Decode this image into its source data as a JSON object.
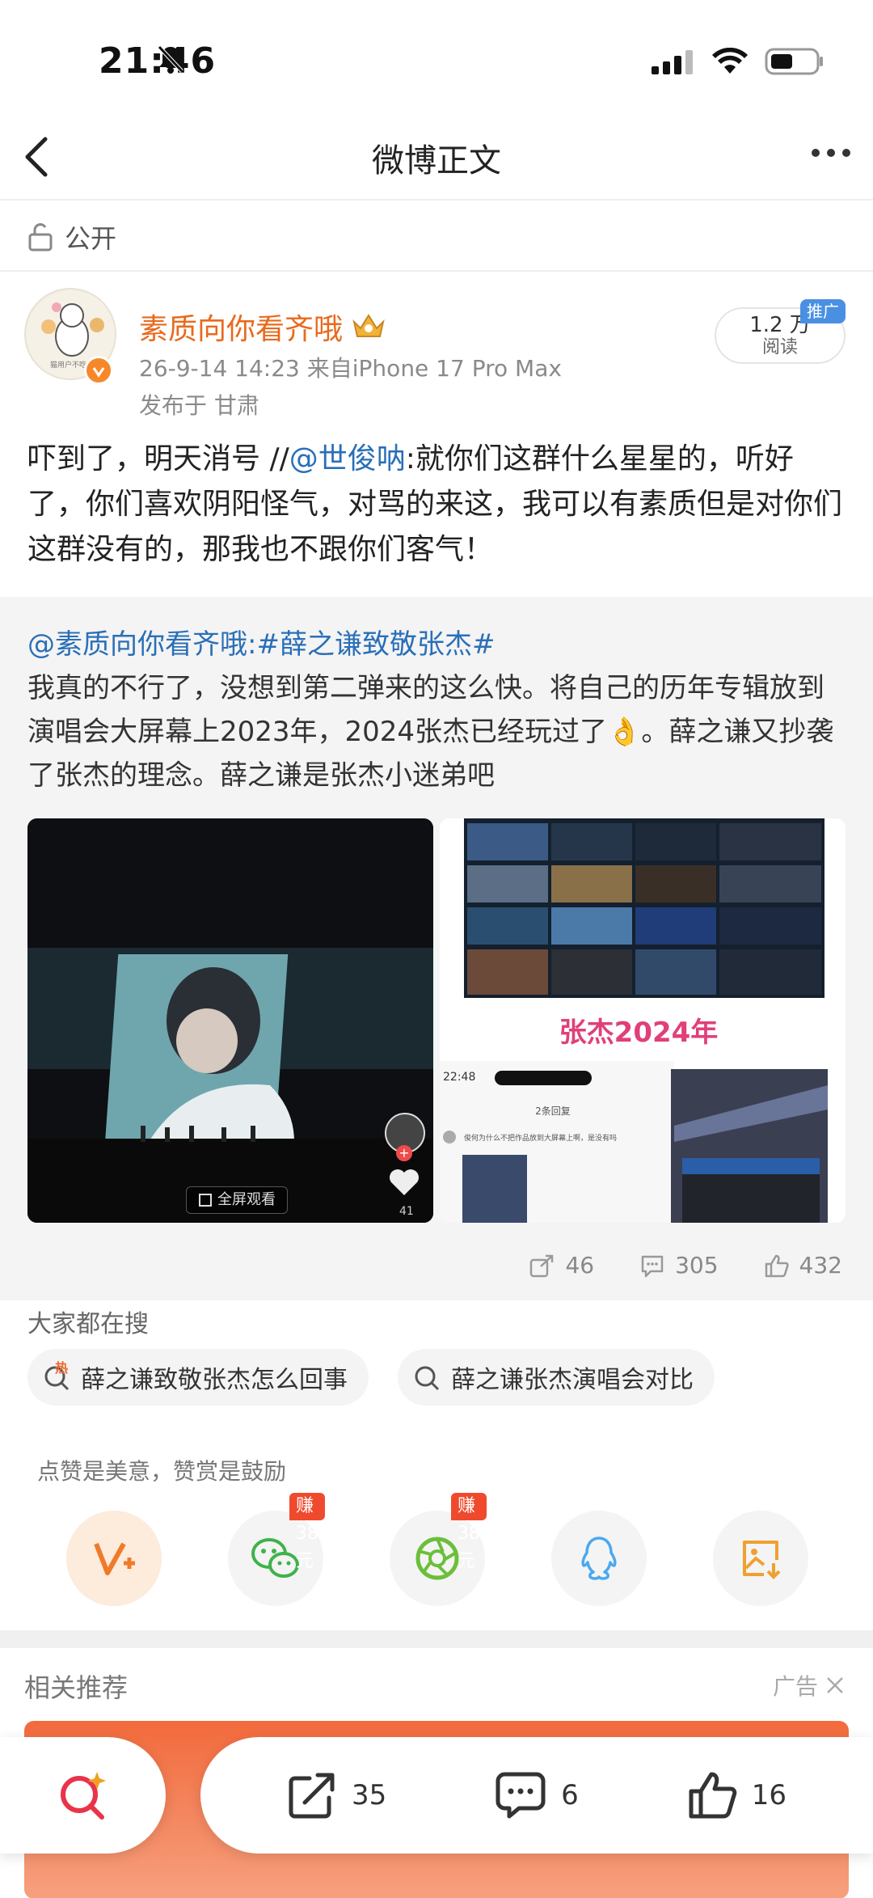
{
  "status_bar": {
    "time": "21:46"
  },
  "nav": {
    "title": "微博正文"
  },
  "visibility": {
    "label": "公开"
  },
  "author": {
    "name": "素质向你看齐哦",
    "meta": "26-9-14 14:23  来自iPhone 17 Pro Max",
    "location": "发布于 甘肃",
    "avatar_caption": "猫用户不吃亏",
    "reads": "1.2 万",
    "reads_label": "阅读",
    "promo_tag": "推广"
  },
  "post": {
    "prefix": "吓到了，明天消号 //",
    "mention": "@世俊呐",
    "body": ":就你们这群什么星星的，听好了，你们喜欢阴阳怪气，对骂的来这，我可以有素质但是对你们这群没有的，那我也不跟你们客气！"
  },
  "repost": {
    "author": "@素质向你看齐哦",
    "topic": ":#薛之谦致敬张杰#",
    "body": "我真的不行了，没想到第二弹来的这么快。将自己的历年专辑放到演唱会大屏幕上2023年，2024张杰已经玩过了👌。薛之谦又抄袭了张杰的理念。薛之谦是张杰小迷弟吧",
    "video_fullscreen": "全屏观看",
    "video_likes": "41",
    "image_caption": "张杰2024年",
    "screenshot_time": "22:48",
    "screenshot_replies": "2条回复",
    "screenshot_comment": "俊何为什么不把作品放到大屏幕上啊，是没有吗",
    "shares": "46",
    "comments": "305",
    "likes": "432"
  },
  "hot_search": {
    "title": "大家都在搜",
    "items": [
      {
        "label": "薛之谦致敬张杰怎么回事",
        "badge": "热"
      },
      {
        "label": "薛之谦张杰演唱会对比"
      }
    ]
  },
  "reward": {
    "hint": "点赞是美意，赞赏是鼓励",
    "buttons": [
      {
        "name": "reward",
        "badge": ""
      },
      {
        "name": "wechat",
        "badge": "赚38元"
      },
      {
        "name": "moments",
        "badge": "赚38元"
      },
      {
        "name": "qq",
        "badge": ""
      },
      {
        "name": "save-image",
        "badge": ""
      }
    ]
  },
  "related": {
    "title": "相关推荐",
    "ad_label": "广告"
  },
  "bottom_bar": {
    "shares": "35",
    "comments": "6",
    "likes": "16"
  },
  "colors": {
    "brand_orange": "#e86a1c",
    "link_blue": "#2a6fb8",
    "reward_red": "#f04a2e"
  }
}
